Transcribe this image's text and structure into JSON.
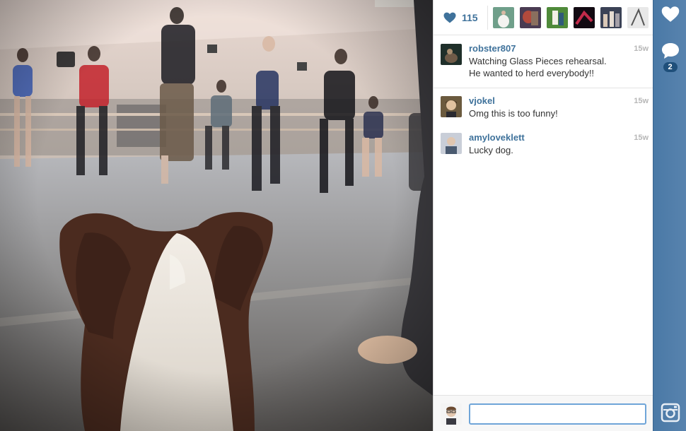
{
  "photo": {
    "subject": "dog-and-dancers-photo"
  },
  "likes": {
    "count": "115",
    "likers": [
      "liker-avatar-1",
      "liker-avatar-2",
      "liker-avatar-3",
      "liker-avatar-4",
      "liker-avatar-5",
      "liker-avatar-6"
    ]
  },
  "caption": {
    "username": "robster807",
    "text": "Watching Glass Pieces rehearsal. He wanted to herd everybody!!",
    "time": "15w"
  },
  "comments": [
    {
      "username": "vjokel",
      "text": "Omg this is too funny!",
      "time": "15w"
    },
    {
      "username": "amyloveklett",
      "text": "Lucky dog.",
      "time": "15w"
    }
  ],
  "composer": {
    "value": "",
    "placeholder": ""
  },
  "rail": {
    "like_icon": "heart-icon",
    "comment_icon": "speech-bubble-icon",
    "comment_count": "2",
    "brand_icon": "instagram-camera-icon"
  },
  "colors": {
    "accent": "#3f729b",
    "rail": "#5380ac",
    "badge": "#1f4f7a",
    "time": "#b7b7b7"
  }
}
